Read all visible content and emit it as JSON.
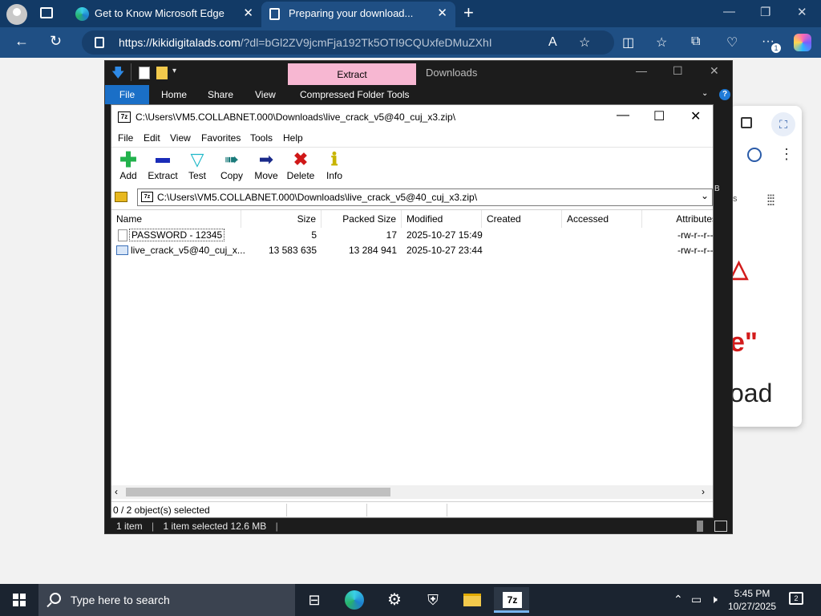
{
  "browser": {
    "tabs": [
      {
        "title": "Get to Know Microsoft Edge"
      },
      {
        "title": "Preparing your download..."
      }
    ],
    "url_host": "https://kikidigitalads.com",
    "url_rest": "/?dl=bGl2ZV9jcmFja192Tk5OTI9CQUxfeDMuZXhI",
    "read_aloud_label": "A",
    "badge_count": "1"
  },
  "page_behind": {
    "popup_quote": "e\"",
    "popup_word": "oad",
    "popup_side_text": "s",
    "popup_partial_b": "B"
  },
  "explorer": {
    "context_tab": "Extract",
    "title": "Downloads",
    "ribbon_tabs": [
      "File",
      "Home",
      "Share",
      "View",
      "Compressed Folder Tools"
    ],
    "help": "?",
    "status_items": "1 item",
    "status_selected": "1 item selected  12.6 MB"
  },
  "sevenzip": {
    "app_icon": "7z",
    "title": "C:\\Users\\VM5.COLLABNET.000\\Downloads\\live_crack_v5@40_cuj_x3.zip\\",
    "menu": [
      "File",
      "Edit",
      "View",
      "Favorites",
      "Tools",
      "Help"
    ],
    "toolbar": [
      {
        "label": "Add",
        "icon": "plus-icon",
        "color": "#22b24c"
      },
      {
        "label": "Extract",
        "icon": "minus-icon",
        "color": "#1a2cb8"
      },
      {
        "label": "Test",
        "icon": "check-icon",
        "color": "#20b8c8"
      },
      {
        "label": "Copy",
        "icon": "double-arrow-icon",
        "color": "#1a7a7a"
      },
      {
        "label": "Move",
        "icon": "arrow-right-icon",
        "color": "#1a2a8a"
      },
      {
        "label": "Delete",
        "icon": "x-icon",
        "color": "#d01818"
      },
      {
        "label": "Info",
        "icon": "info-icon",
        "color": "#d8c400"
      }
    ],
    "path": "C:\\Users\\VM5.COLLABNET.000\\Downloads\\live_crack_v5@40_cuj_x3.zip\\",
    "columns": [
      "Name",
      "Size",
      "Packed Size",
      "Modified",
      "Created",
      "Accessed",
      "Attributes"
    ],
    "rows": [
      {
        "name": "PASSWORD - 12345",
        "size": "5",
        "packed": "17",
        "modified": "2025-10-27 15:49",
        "created": "",
        "accessed": "",
        "attributes": "-rw-r--r--"
      },
      {
        "name": "live_crack_v5@40_cuj_x...",
        "size": "13 583 635",
        "packed": "13 284 941",
        "modified": "2025-10-27 23:44",
        "created": "",
        "accessed": "",
        "attributes": "-rw-r--r--"
      }
    ],
    "status": "0 / 2 object(s) selected"
  },
  "taskbar": {
    "search_placeholder": "Type here to search",
    "time": "5:45 PM",
    "date": "10/27/2025",
    "notification_count": "2",
    "taskbar_7z_label": "7z"
  }
}
